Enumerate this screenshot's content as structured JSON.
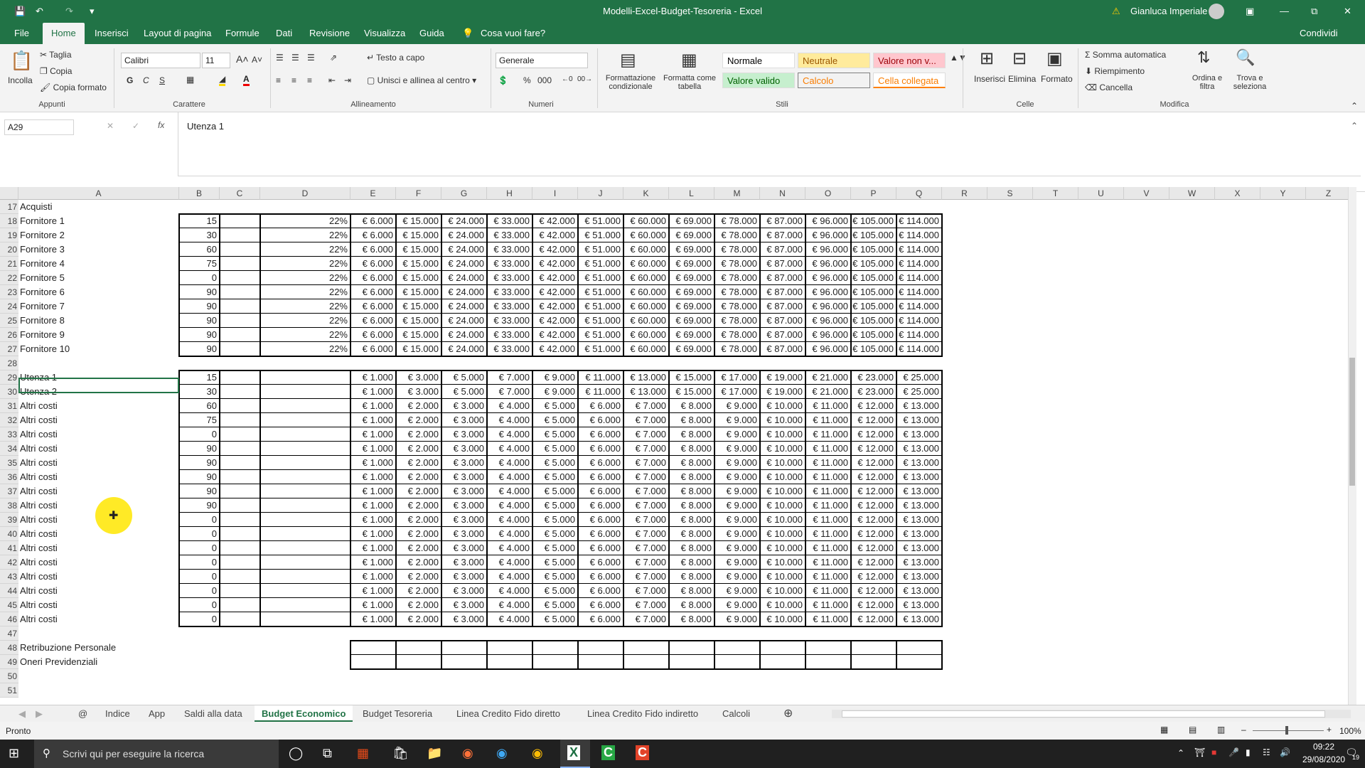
{
  "window": {
    "title": "Modelli-Excel-Budget-Tesoreria - Excel",
    "user": "Gianluca Imperiale"
  },
  "menu": [
    "File",
    "Home",
    "Inserisci",
    "Layout di pagina",
    "Formule",
    "Dati",
    "Revisione",
    "Visualizza",
    "Guida"
  ],
  "menu_tell": "Cosa vuoi fare?",
  "menu_share": "Condividi",
  "ribbon": {
    "paste": "Incolla",
    "cut": "Taglia",
    "copy": "Copia",
    "format_painter": "Copia formato",
    "font": "Calibri",
    "size": "11",
    "wrap": "Testo a capo",
    "merge": "Unisci e allinea al centro",
    "number_format": "Generale",
    "cond_format": "Formattazione condizionale",
    "format_table": "Formatta come tabella",
    "styles": [
      "Normale",
      "Neutrale",
      "Valore non v...",
      "Valore valido",
      "Calcolo",
      "Cella collegata"
    ],
    "insert": "Inserisci",
    "delete": "Elimina",
    "format": "Formato",
    "autosum": "Somma automatica",
    "fill": "Riempimento",
    "clear": "Cancella",
    "sort": "Ordina e filtra",
    "find": "Trova e seleziona",
    "groups": [
      "Appunti",
      "Carattere",
      "Allineamento",
      "Numeri",
      "Stili",
      "Celle",
      "Modifica"
    ]
  },
  "formula_bar": {
    "name_box": "A29",
    "content": "Utenza 1"
  },
  "columns": [
    "A",
    "B",
    "C",
    "D",
    "E",
    "F",
    "G",
    "H",
    "I",
    "J",
    "K",
    "L",
    "M",
    "N",
    "O",
    "P",
    "Q",
    "R",
    "S",
    "T",
    "U",
    "V",
    "W",
    "X",
    "Y",
    "Z"
  ],
  "rows": [
    {
      "n": "17",
      "label": "Acquisti",
      "b": "",
      "d": "",
      "vals": []
    },
    {
      "n": "18",
      "label": "Fornitore 1",
      "b": "15",
      "d": "22%",
      "vals": [
        "€ 6.000",
        "€ 15.000",
        "€ 24.000",
        "€ 33.000",
        "€ 42.000",
        "€ 51.000",
        "€ 60.000",
        "€ 69.000",
        "€ 78.000",
        "€ 87.000",
        "€ 96.000",
        "€ 105.000",
        "€ 114.000"
      ]
    },
    {
      "n": "19",
      "label": "Fornitore 2",
      "b": "30",
      "d": "22%",
      "vals": [
        "€ 6.000",
        "€ 15.000",
        "€ 24.000",
        "€ 33.000",
        "€ 42.000",
        "€ 51.000",
        "€ 60.000",
        "€ 69.000",
        "€ 78.000",
        "€ 87.000",
        "€ 96.000",
        "€ 105.000",
        "€ 114.000"
      ]
    },
    {
      "n": "20",
      "label": "Fornitore 3",
      "b": "60",
      "d": "22%",
      "vals": [
        "€ 6.000",
        "€ 15.000",
        "€ 24.000",
        "€ 33.000",
        "€ 42.000",
        "€ 51.000",
        "€ 60.000",
        "€ 69.000",
        "€ 78.000",
        "€ 87.000",
        "€ 96.000",
        "€ 105.000",
        "€ 114.000"
      ]
    },
    {
      "n": "21",
      "label": "Fornitore 4",
      "b": "75",
      "d": "22%",
      "vals": [
        "€ 6.000",
        "€ 15.000",
        "€ 24.000",
        "€ 33.000",
        "€ 42.000",
        "€ 51.000",
        "€ 60.000",
        "€ 69.000",
        "€ 78.000",
        "€ 87.000",
        "€ 96.000",
        "€ 105.000",
        "€ 114.000"
      ]
    },
    {
      "n": "22",
      "label": "Fornitore 5",
      "b": "0",
      "d": "22%",
      "vals": [
        "€ 6.000",
        "€ 15.000",
        "€ 24.000",
        "€ 33.000",
        "€ 42.000",
        "€ 51.000",
        "€ 60.000",
        "€ 69.000",
        "€ 78.000",
        "€ 87.000",
        "€ 96.000",
        "€ 105.000",
        "€ 114.000"
      ]
    },
    {
      "n": "23",
      "label": "Fornitore 6",
      "b": "90",
      "d": "22%",
      "vals": [
        "€ 6.000",
        "€ 15.000",
        "€ 24.000",
        "€ 33.000",
        "€ 42.000",
        "€ 51.000",
        "€ 60.000",
        "€ 69.000",
        "€ 78.000",
        "€ 87.000",
        "€ 96.000",
        "€ 105.000",
        "€ 114.000"
      ]
    },
    {
      "n": "24",
      "label": "Fornitore 7",
      "b": "90",
      "d": "22%",
      "vals": [
        "€ 6.000",
        "€ 15.000",
        "€ 24.000",
        "€ 33.000",
        "€ 42.000",
        "€ 51.000",
        "€ 60.000",
        "€ 69.000",
        "€ 78.000",
        "€ 87.000",
        "€ 96.000",
        "€ 105.000",
        "€ 114.000"
      ]
    },
    {
      "n": "25",
      "label": "Fornitore 8",
      "b": "90",
      "d": "22%",
      "vals": [
        "€ 6.000",
        "€ 15.000",
        "€ 24.000",
        "€ 33.000",
        "€ 42.000",
        "€ 51.000",
        "€ 60.000",
        "€ 69.000",
        "€ 78.000",
        "€ 87.000",
        "€ 96.000",
        "€ 105.000",
        "€ 114.000"
      ]
    },
    {
      "n": "26",
      "label": "Fornitore 9",
      "b": "90",
      "d": "22%",
      "vals": [
        "€ 6.000",
        "€ 15.000",
        "€ 24.000",
        "€ 33.000",
        "€ 42.000",
        "€ 51.000",
        "€ 60.000",
        "€ 69.000",
        "€ 78.000",
        "€ 87.000",
        "€ 96.000",
        "€ 105.000",
        "€ 114.000"
      ]
    },
    {
      "n": "27",
      "label": "Fornitore 10",
      "b": "90",
      "d": "22%",
      "vals": [
        "€ 6.000",
        "€ 15.000",
        "€ 24.000",
        "€ 33.000",
        "€ 42.000",
        "€ 51.000",
        "€ 60.000",
        "€ 69.000",
        "€ 78.000",
        "€ 87.000",
        "€ 96.000",
        "€ 105.000",
        "€ 114.000"
      ]
    },
    {
      "n": "28",
      "label": "",
      "b": "",
      "d": "",
      "vals": []
    },
    {
      "n": "29",
      "label": "Utenza 1",
      "b": "15",
      "d": "",
      "vals": [
        "€ 1.000",
        "€ 3.000",
        "€ 5.000",
        "€ 7.000",
        "€ 9.000",
        "€ 11.000",
        "€ 13.000",
        "€ 15.000",
        "€ 17.000",
        "€ 19.000",
        "€ 21.000",
        "€ 23.000",
        "€ 25.000"
      ]
    },
    {
      "n": "30",
      "label": "Utenza 2",
      "b": "30",
      "d": "",
      "vals": [
        "€ 1.000",
        "€ 3.000",
        "€ 5.000",
        "€ 7.000",
        "€ 9.000",
        "€ 11.000",
        "€ 13.000",
        "€ 15.000",
        "€ 17.000",
        "€ 19.000",
        "€ 21.000",
        "€ 23.000",
        "€ 25.000"
      ]
    },
    {
      "n": "31",
      "label": "Altri costi",
      "b": "60",
      "d": "",
      "vals": [
        "€ 1.000",
        "€ 2.000",
        "€ 3.000",
        "€ 4.000",
        "€ 5.000",
        "€ 6.000",
        "€ 7.000",
        "€ 8.000",
        "€ 9.000",
        "€ 10.000",
        "€ 11.000",
        "€ 12.000",
        "€ 13.000"
      ]
    },
    {
      "n": "32",
      "label": "Altri costi",
      "b": "75",
      "d": "",
      "vals": [
        "€ 1.000",
        "€ 2.000",
        "€ 3.000",
        "€ 4.000",
        "€ 5.000",
        "€ 6.000",
        "€ 7.000",
        "€ 8.000",
        "€ 9.000",
        "€ 10.000",
        "€ 11.000",
        "€ 12.000",
        "€ 13.000"
      ]
    },
    {
      "n": "33",
      "label": "Altri costi",
      "b": "0",
      "d": "",
      "vals": [
        "€ 1.000",
        "€ 2.000",
        "€ 3.000",
        "€ 4.000",
        "€ 5.000",
        "€ 6.000",
        "€ 7.000",
        "€ 8.000",
        "€ 9.000",
        "€ 10.000",
        "€ 11.000",
        "€ 12.000",
        "€ 13.000"
      ]
    },
    {
      "n": "34",
      "label": "Altri costi",
      "b": "90",
      "d": "",
      "vals": [
        "€ 1.000",
        "€ 2.000",
        "€ 3.000",
        "€ 4.000",
        "€ 5.000",
        "€ 6.000",
        "€ 7.000",
        "€ 8.000",
        "€ 9.000",
        "€ 10.000",
        "€ 11.000",
        "€ 12.000",
        "€ 13.000"
      ]
    },
    {
      "n": "35",
      "label": "Altri costi",
      "b": "90",
      "d": "",
      "vals": [
        "€ 1.000",
        "€ 2.000",
        "€ 3.000",
        "€ 4.000",
        "€ 5.000",
        "€ 6.000",
        "€ 7.000",
        "€ 8.000",
        "€ 9.000",
        "€ 10.000",
        "€ 11.000",
        "€ 12.000",
        "€ 13.000"
      ]
    },
    {
      "n": "36",
      "label": "Altri costi",
      "b": "90",
      "d": "",
      "vals": [
        "€ 1.000",
        "€ 2.000",
        "€ 3.000",
        "€ 4.000",
        "€ 5.000",
        "€ 6.000",
        "€ 7.000",
        "€ 8.000",
        "€ 9.000",
        "€ 10.000",
        "€ 11.000",
        "€ 12.000",
        "€ 13.000"
      ]
    },
    {
      "n": "37",
      "label": "Altri costi",
      "b": "90",
      "d": "",
      "vals": [
        "€ 1.000",
        "€ 2.000",
        "€ 3.000",
        "€ 4.000",
        "€ 5.000",
        "€ 6.000",
        "€ 7.000",
        "€ 8.000",
        "€ 9.000",
        "€ 10.000",
        "€ 11.000",
        "€ 12.000",
        "€ 13.000"
      ]
    },
    {
      "n": "38",
      "label": "Altri costi",
      "b": "90",
      "d": "",
      "vals": [
        "€ 1.000",
        "€ 2.000",
        "€ 3.000",
        "€ 4.000",
        "€ 5.000",
        "€ 6.000",
        "€ 7.000",
        "€ 8.000",
        "€ 9.000",
        "€ 10.000",
        "€ 11.000",
        "€ 12.000",
        "€ 13.000"
      ]
    },
    {
      "n": "39",
      "label": "Altri costi",
      "b": "0",
      "d": "",
      "vals": [
        "€ 1.000",
        "€ 2.000",
        "€ 3.000",
        "€ 4.000",
        "€ 5.000",
        "€ 6.000",
        "€ 7.000",
        "€ 8.000",
        "€ 9.000",
        "€ 10.000",
        "€ 11.000",
        "€ 12.000",
        "€ 13.000"
      ]
    },
    {
      "n": "40",
      "label": "Altri costi",
      "b": "0",
      "d": "",
      "vals": [
        "€ 1.000",
        "€ 2.000",
        "€ 3.000",
        "€ 4.000",
        "€ 5.000",
        "€ 6.000",
        "€ 7.000",
        "€ 8.000",
        "€ 9.000",
        "€ 10.000",
        "€ 11.000",
        "€ 12.000",
        "€ 13.000"
      ]
    },
    {
      "n": "41",
      "label": "Altri costi",
      "b": "0",
      "d": "",
      "vals": [
        "€ 1.000",
        "€ 2.000",
        "€ 3.000",
        "€ 4.000",
        "€ 5.000",
        "€ 6.000",
        "€ 7.000",
        "€ 8.000",
        "€ 9.000",
        "€ 10.000",
        "€ 11.000",
        "€ 12.000",
        "€ 13.000"
      ]
    },
    {
      "n": "42",
      "label": "Altri costi",
      "b": "0",
      "d": "",
      "vals": [
        "€ 1.000",
        "€ 2.000",
        "€ 3.000",
        "€ 4.000",
        "€ 5.000",
        "€ 6.000",
        "€ 7.000",
        "€ 8.000",
        "€ 9.000",
        "€ 10.000",
        "€ 11.000",
        "€ 12.000",
        "€ 13.000"
      ]
    },
    {
      "n": "43",
      "label": "Altri costi",
      "b": "0",
      "d": "",
      "vals": [
        "€ 1.000",
        "€ 2.000",
        "€ 3.000",
        "€ 4.000",
        "€ 5.000",
        "€ 6.000",
        "€ 7.000",
        "€ 8.000",
        "€ 9.000",
        "€ 10.000",
        "€ 11.000",
        "€ 12.000",
        "€ 13.000"
      ]
    },
    {
      "n": "44",
      "label": "Altri costi",
      "b": "0",
      "d": "",
      "vals": [
        "€ 1.000",
        "€ 2.000",
        "€ 3.000",
        "€ 4.000",
        "€ 5.000",
        "€ 6.000",
        "€ 7.000",
        "€ 8.000",
        "€ 9.000",
        "€ 10.000",
        "€ 11.000",
        "€ 12.000",
        "€ 13.000"
      ]
    },
    {
      "n": "45",
      "label": "Altri costi",
      "b": "0",
      "d": "",
      "vals": [
        "€ 1.000",
        "€ 2.000",
        "€ 3.000",
        "€ 4.000",
        "€ 5.000",
        "€ 6.000",
        "€ 7.000",
        "€ 8.000",
        "€ 9.000",
        "€ 10.000",
        "€ 11.000",
        "€ 12.000",
        "€ 13.000"
      ]
    },
    {
      "n": "46",
      "label": "Altri costi",
      "b": "0",
      "d": "",
      "vals": [
        "€ 1.000",
        "€ 2.000",
        "€ 3.000",
        "€ 4.000",
        "€ 5.000",
        "€ 6.000",
        "€ 7.000",
        "€ 8.000",
        "€ 9.000",
        "€ 10.000",
        "€ 11.000",
        "€ 12.000",
        "€ 13.000"
      ]
    },
    {
      "n": "47",
      "label": "",
      "b": "",
      "d": "",
      "vals": []
    },
    {
      "n": "48",
      "label": "Retribuzione Personale",
      "b": "",
      "d": "",
      "vals": []
    },
    {
      "n": "49",
      "label": "Oneri Previdenziali",
      "b": "",
      "d": "",
      "vals": []
    },
    {
      "n": "50",
      "label": "",
      "b": "",
      "d": "",
      "vals": []
    },
    {
      "n": "51",
      "label": "",
      "b": "",
      "d": "",
      "vals": []
    }
  ],
  "sheet_tabs": [
    "Indice",
    "App",
    "Saldi alla data",
    "Budget Economico",
    "Budget Tesoreria",
    "Linea Credito Fido diretto",
    "Linea Credito Fido indiretto",
    "Calcoli"
  ],
  "active_sheet": "Budget Economico",
  "status": {
    "ready": "Pronto",
    "zoom": "100%"
  },
  "taskbar": {
    "search": "Scrivi qui per eseguire la ricerca",
    "time": "09:22",
    "date": "29/08/2020",
    "notif": "19"
  }
}
